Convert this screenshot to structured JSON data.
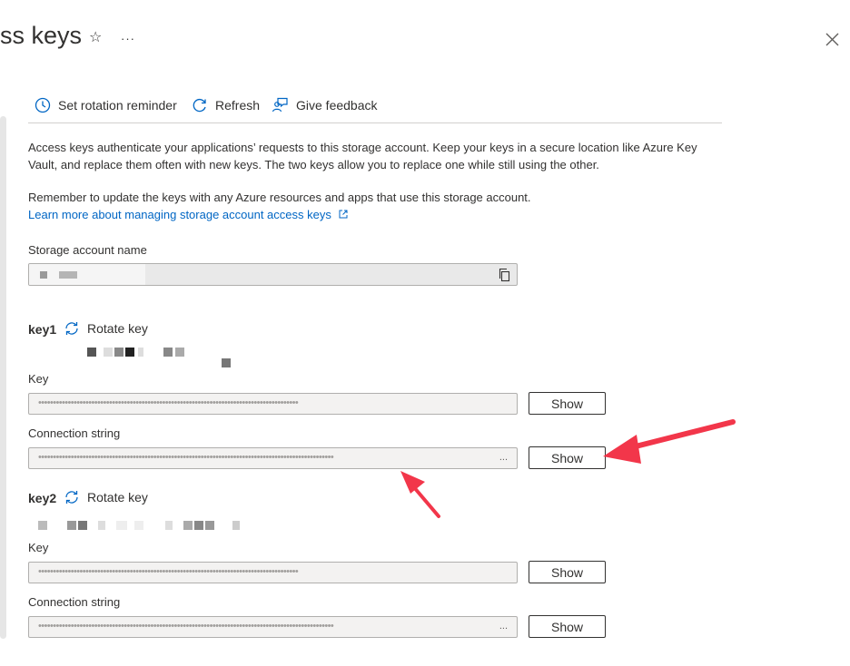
{
  "header": {
    "title": "ss keys",
    "star_glyph": "☆",
    "more_glyph": "···"
  },
  "toolbar": {
    "rotation_label": "Set rotation reminder",
    "refresh_label": "Refresh",
    "feedback_label": "Give feedback"
  },
  "intro": {
    "paragraph1": "Access keys authenticate your applications’ requests to this storage account. Keep your keys in a secure location like Azure Key Vault, and replace them often with new keys. The two keys allow you to replace one while still using the other.",
    "paragraph2": "Remember to update the keys with any Azure resources and apps that use this storage account.",
    "learn_more": "Learn more about managing storage account access keys"
  },
  "storage_account": {
    "label": "Storage account name"
  },
  "key1": {
    "title": "key1",
    "rotate_label": "Rotate key",
    "key_label": "Key",
    "key_value": "••••••••••••••••••••••••••••••••••••••••••••••••••••••••••••••••••••••••••••••••••••••••",
    "connection_label": "Connection string",
    "connection_value": "••••••••••••••••••••••••••••••••••••••••••••••••••••••••••••••••••••••••••••••••••••••••••••••••••••",
    "connection_ellipsis": "...",
    "show_key": "Show",
    "show_connection": "Show"
  },
  "key2": {
    "title": "key2",
    "rotate_label": "Rotate key",
    "key_label": "Key",
    "key_value": "••••••••••••••••••••••••••••••••••••••••••••••••••••••••••••••••••••••••••••••••••••••••",
    "connection_label": "Connection string",
    "connection_value": "••••••••••••••••••••••••••••••••••••••••••••••••••••••••••••••••••••••••••••••••••••••••••••••••••••",
    "connection_ellipsis": "...",
    "show_key": "Show",
    "show_connection": "Show"
  },
  "colors": {
    "accent": "#0066c4",
    "annotation_arrow": "#f2364a"
  }
}
